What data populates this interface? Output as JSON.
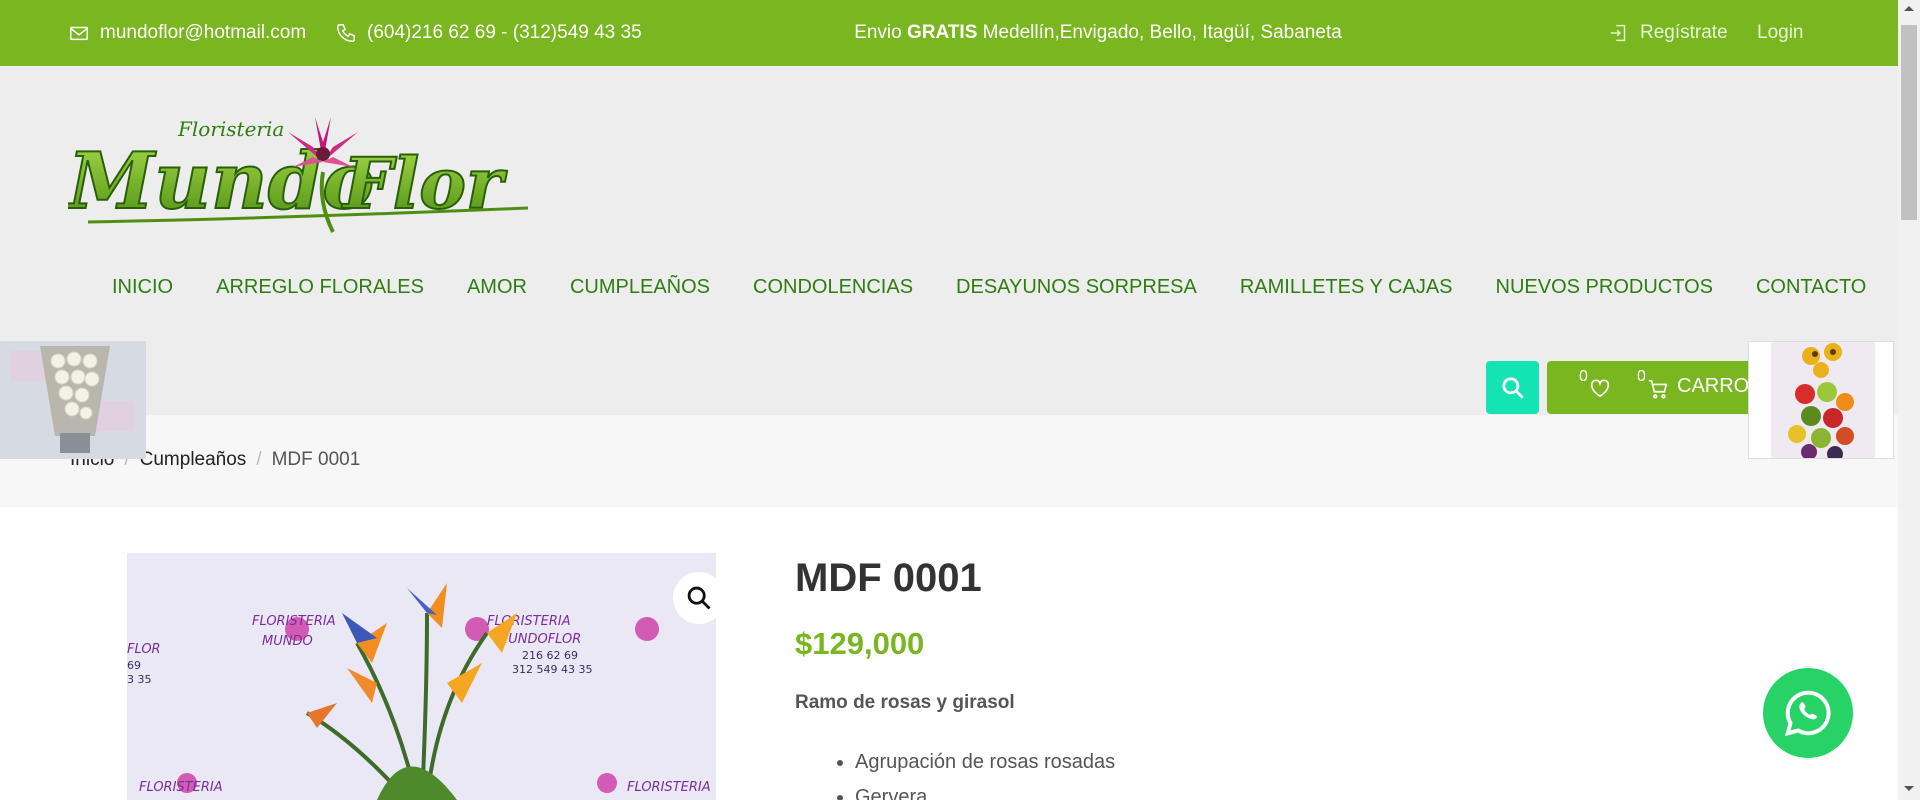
{
  "topbar": {
    "email": "mundoflor@hotmail.com",
    "phone": "(604)216 62 69 - (312)549 43 35",
    "promo_prefix": "Envio ",
    "promo_bold": "GRATIS",
    "promo_rest": " Medellín,Envigado, Bello, Itagüí, Sabaneta",
    "register": "Regístrate",
    "login": "Login"
  },
  "logo": {
    "small_text": "FLORISTERIA",
    "brand": "Mundo Flor"
  },
  "nav": [
    "INICIO",
    "ARREGLO FLORALES",
    "AMOR",
    "CUMPLEAÑOS",
    "CONDOLENCIAS",
    "DESAYUNOS SORPRESA",
    "RAMILLETES Y CAJAS",
    "NUEVOS PRODUCTOS",
    "CONTACTO"
  ],
  "cart": {
    "wishlist_count": "0",
    "cart_count": "0",
    "label": "CARRO"
  },
  "breadcrumb": {
    "home": "Inicio",
    "category": "Cumpleaños",
    "current": "MDF 0001"
  },
  "product": {
    "title": "MDF 0001",
    "price": "$129,000",
    "description_title": "Ramo de rosas y girasol",
    "bullets": [
      "Agrupación de rosas rosadas",
      "Gervera"
    ]
  },
  "colors": {
    "brand_green": "#7ab620",
    "nav_green": "#2f7d10",
    "search_teal": "#14e3b6",
    "whatsapp": "#27d366"
  },
  "icons": [
    "envelope-icon",
    "phone-icon",
    "login-icon",
    "search-icon",
    "heart-icon",
    "cart-icon",
    "zoom-icon",
    "whatsapp-icon"
  ]
}
